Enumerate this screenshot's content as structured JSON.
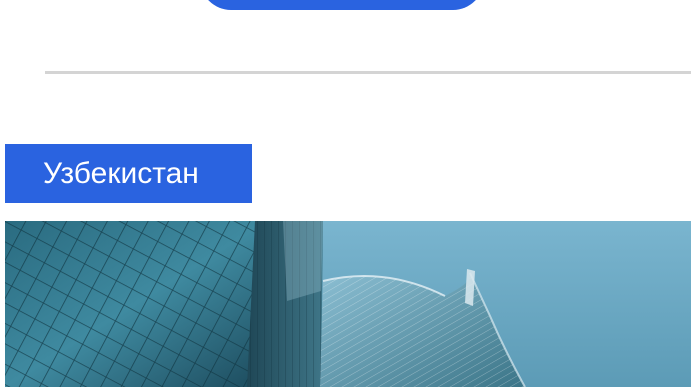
{
  "top_button": {
    "label": ""
  },
  "country_section": {
    "title": "Узбекистан"
  },
  "hero_image": {
    "subject": "skyscrapers-photo"
  },
  "colors": {
    "accent": "#2a63e0",
    "divider": "#d4d4d4",
    "sky": "#6aa8c4",
    "glass_dark": "#1c4a5c"
  }
}
